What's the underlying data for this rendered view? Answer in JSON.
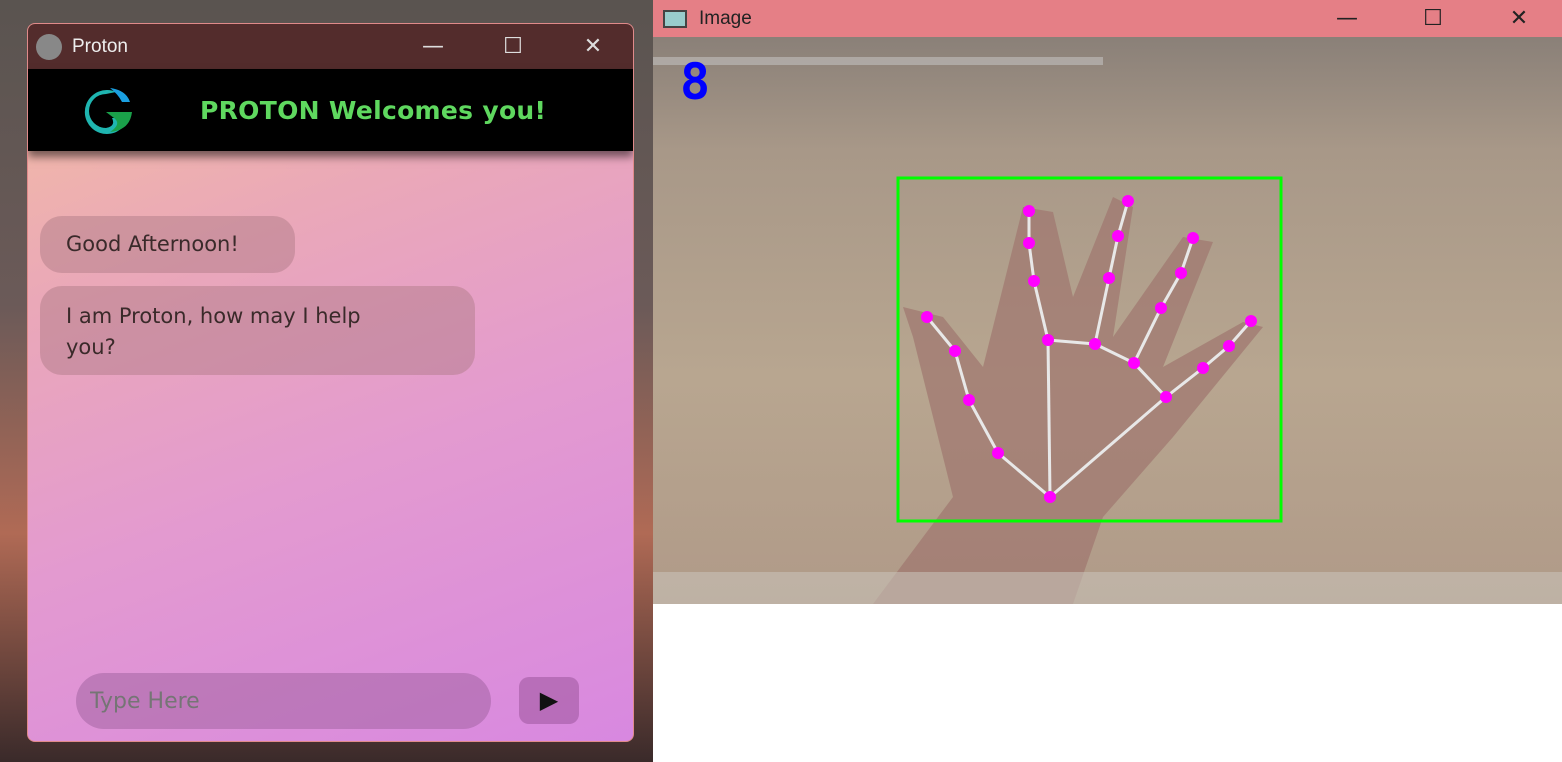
{
  "proton_window": {
    "title": "Proton",
    "controls": {
      "minimize": "—",
      "maximize": "☐",
      "close": "✕"
    },
    "banner_title": "PROTON Welcomes you!",
    "messages": [
      "Good Afternoon!",
      "I am Proton, how may I help you?"
    ],
    "input": {
      "value": "",
      "placeholder": "Type Here"
    },
    "send_label": "▶"
  },
  "image_window": {
    "title": "Image",
    "controls": {
      "minimize": "—",
      "maximize": "☐",
      "close": "✕"
    },
    "finger_count": "8",
    "colors": {
      "bbox": "#00ff00",
      "landmark": "#ff00ff",
      "connection": "#e8e8e8",
      "count": "#0000ff"
    }
  }
}
